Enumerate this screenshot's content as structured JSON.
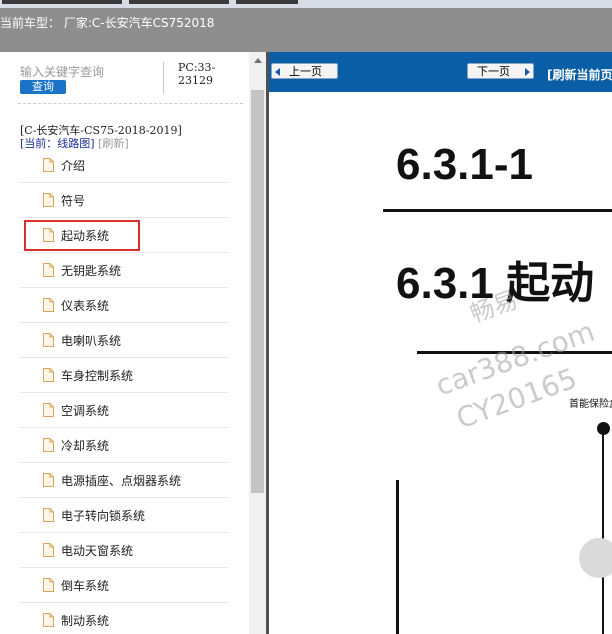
{
  "header": {
    "car_type_label": "当前车型：",
    "car_type_value": "厂家:C-长安汽车CS752018"
  },
  "left": {
    "search": {
      "placeholder": "输入关键字查询",
      "button_label": "查询"
    },
    "pc_code": "PC:33-23129",
    "model_line": "[C-长安汽车-CS75-2018-2019]",
    "current_label": "[当前：线路图]",
    "refresh_label": "[刷新]",
    "tree": [
      "介绍",
      "符号",
      "起动系统",
      "无钥匙系统",
      "仪表系统",
      "电喇叭系统",
      "车身控制系统",
      "空调系统",
      "冷却系统",
      "电源插座、点烟器系统",
      "电子转向锁系统",
      "电动天窗系统",
      "倒车系统",
      "制动系统"
    ],
    "selected_index": 2
  },
  "toolbar": {
    "prev_label": "上一页",
    "next_label": "下一页",
    "refresh_label": "[刷新当前页"
  },
  "document": {
    "title1": "6.3.1-1",
    "title2": "6.3.1 起动",
    "fuse_label": "首能保险盒"
  },
  "watermark": {
    "line1": "畅易",
    "line2": "car388.com",
    "line3": "CY20165"
  },
  "colors": {
    "header_bg": "#8e8e8e",
    "toolbar_bg": "#0a5ea5",
    "button_blue": "#1a73c6",
    "selection_red": "#d9302a"
  },
  "icons": {
    "tree_item": "document-icon",
    "prev": "arrow-left-icon",
    "next": "arrow-right-icon"
  }
}
